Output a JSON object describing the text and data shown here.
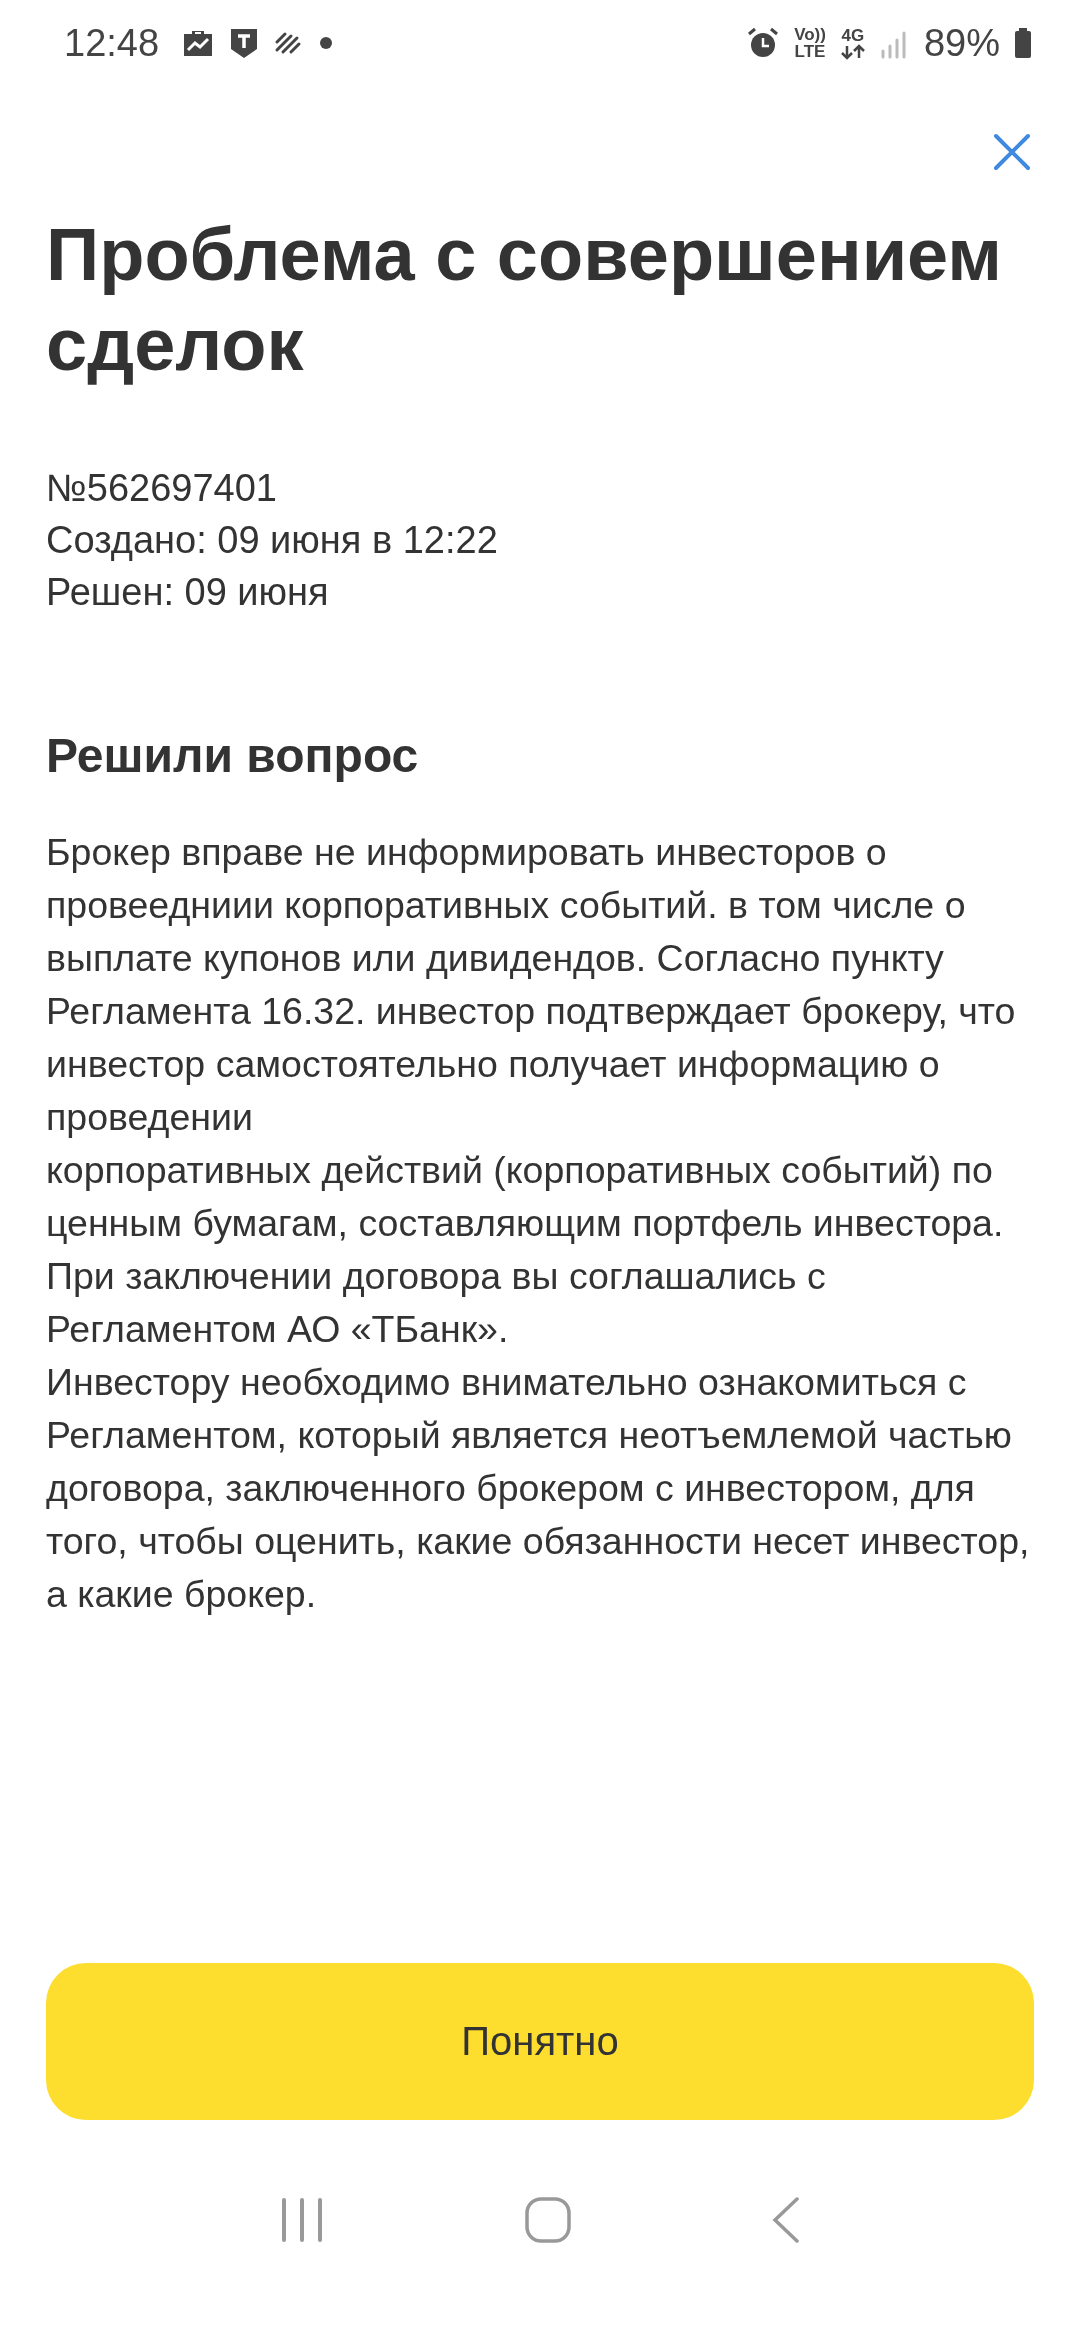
{
  "status_bar": {
    "time": "12:48",
    "volte_top": "Vo))",
    "volte_bottom": "LTE",
    "network": "4G",
    "battery": "89%"
  },
  "title": "Проблема с совершением сделок",
  "meta": [
    "№562697401",
    "Создано: 09 июня в 12:22",
    "Решен: 09 июня"
  ],
  "section_title": "Решили вопрос",
  "paragraphs": [
    "Брокер вправе не информировать инвесторов о провеедниии корпоративных событий. в том числе о выплате купонов или дивидендов. Согласно пункту Регламента 16.32. инвестор подтверждает брокеру, что инвестор самостоятельно получает информацию о проведении",
    "корпоративных действий (корпоративных событий) по ценным бумагам, составляющим портфель инвестора.",
    "При заключении договора вы соглашались с Регламентом АО «ТБанк».",
    "Инвестору необходимо внимательно ознакомиться с Регламентом, который является неотъемлемой частью договора, заключенного брокером с инвестором, для того, чтобы оценить, какие обязанности несет инвестор, а какие брокер."
  ],
  "button": "Понятно"
}
